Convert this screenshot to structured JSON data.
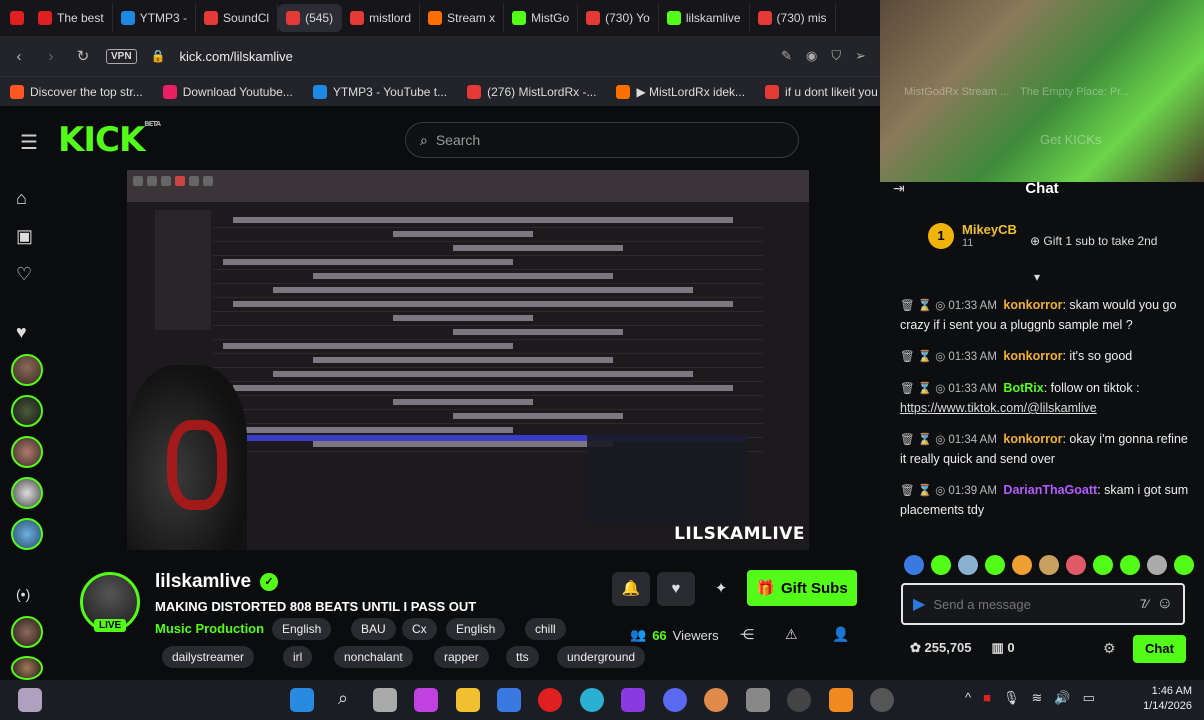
{
  "browser": {
    "tabs": [
      {
        "label": "The best",
        "color": "#e02020"
      },
      {
        "label": "YTMP3 -",
        "color": "#1e88e5"
      },
      {
        "label": "SoundCl",
        "color": "#e53935"
      },
      {
        "label": "(545)",
        "color": "#e53935",
        "active": true
      },
      {
        "label": "mistlord",
        "color": "#e53935"
      },
      {
        "label": "Stream x",
        "color": "#ff6f00"
      },
      {
        "label": "MistGo",
        "color": "#53fc18"
      },
      {
        "label": "(730) Yo",
        "color": "#e53935"
      },
      {
        "label": "lilskamlive",
        "color": "#53fc18"
      },
      {
        "label": "(730) mis",
        "color": "#e53935"
      }
    ],
    "url": "kick.com/lilskamlive",
    "vpn": "VPN",
    "bookmarks": [
      {
        "label": "Discover the top str...",
        "color": "#ff5722"
      },
      {
        "label": "Download Youtube...",
        "color": "#e91e63"
      },
      {
        "label": "YTMP3 - YouTube t...",
        "color": "#1e88e5"
      },
      {
        "label": "(276) MistLordRx -...",
        "color": "#e53935"
      },
      {
        "label": "▶ MistLordRx idek...",
        "color": "#ff6f00"
      },
      {
        "label": "if u dont likeit you b...",
        "color": "#e53935"
      }
    ]
  },
  "site": {
    "logo": "KICK",
    "logo_sup": "BETA",
    "search_placeholder": "Search"
  },
  "video": {
    "watermark": "LILSKAMLIVE"
  },
  "stream": {
    "name": "lilskamlive",
    "title": "MAKING DISTORTED 808 BEATS UNTIL I PASS OUT",
    "category": "Music Production",
    "live": "LIVE",
    "tags_row1": [
      "English",
      "BAU",
      "Cx",
      "English",
      "chill"
    ],
    "tags_row2": [
      "dailystreamer",
      "irl",
      "nonchalant",
      "rapper",
      "tts",
      "underground"
    ],
    "gift_label": "Gift Subs",
    "viewers_count": "66",
    "viewers_label": "Viewers"
  },
  "cam": {
    "overlay1": "MistGodRx Stream ...",
    "overlay2": "The Empty Place: Pr...",
    "overlay3": "Get KICKs"
  },
  "chat": {
    "title": "Chat",
    "pinned": {
      "rank": "1",
      "name": "MikeyCB",
      "months": "11",
      "gift_text": "Gift 1 sub to take 2nd"
    },
    "messages": [
      {
        "time": "01:33 AM",
        "user": "konkorror",
        "color": "#f0b030",
        "text": "skam would you go crazy if i sent you a pluggnb sample mel ?"
      },
      {
        "time": "01:33 AM",
        "user": "konkorror",
        "color": "#f0b030",
        "text": "it's so good"
      },
      {
        "time": "01:33 AM",
        "user": "BotRix",
        "color": "#53fc18",
        "text": "follow on tiktok :",
        "link": "https://www.tiktok.com/@lilskamlive"
      },
      {
        "time": "01:34 AM",
        "user": "konkorror",
        "color": "#f0b030",
        "text": "okay i'm gonna refine it really quick and send over"
      },
      {
        "time": "01:39 AM",
        "user": "DarianThaGoatt",
        "color": "#b05cff",
        "text": "skam i got sum placements tdy"
      }
    ],
    "input_placeholder": "Send a message",
    "points": "255,705",
    "gifts": "0",
    "send_label": "Chat"
  },
  "taskbar": {
    "time": "1:46 AM",
    "date": "1/14/2026"
  }
}
